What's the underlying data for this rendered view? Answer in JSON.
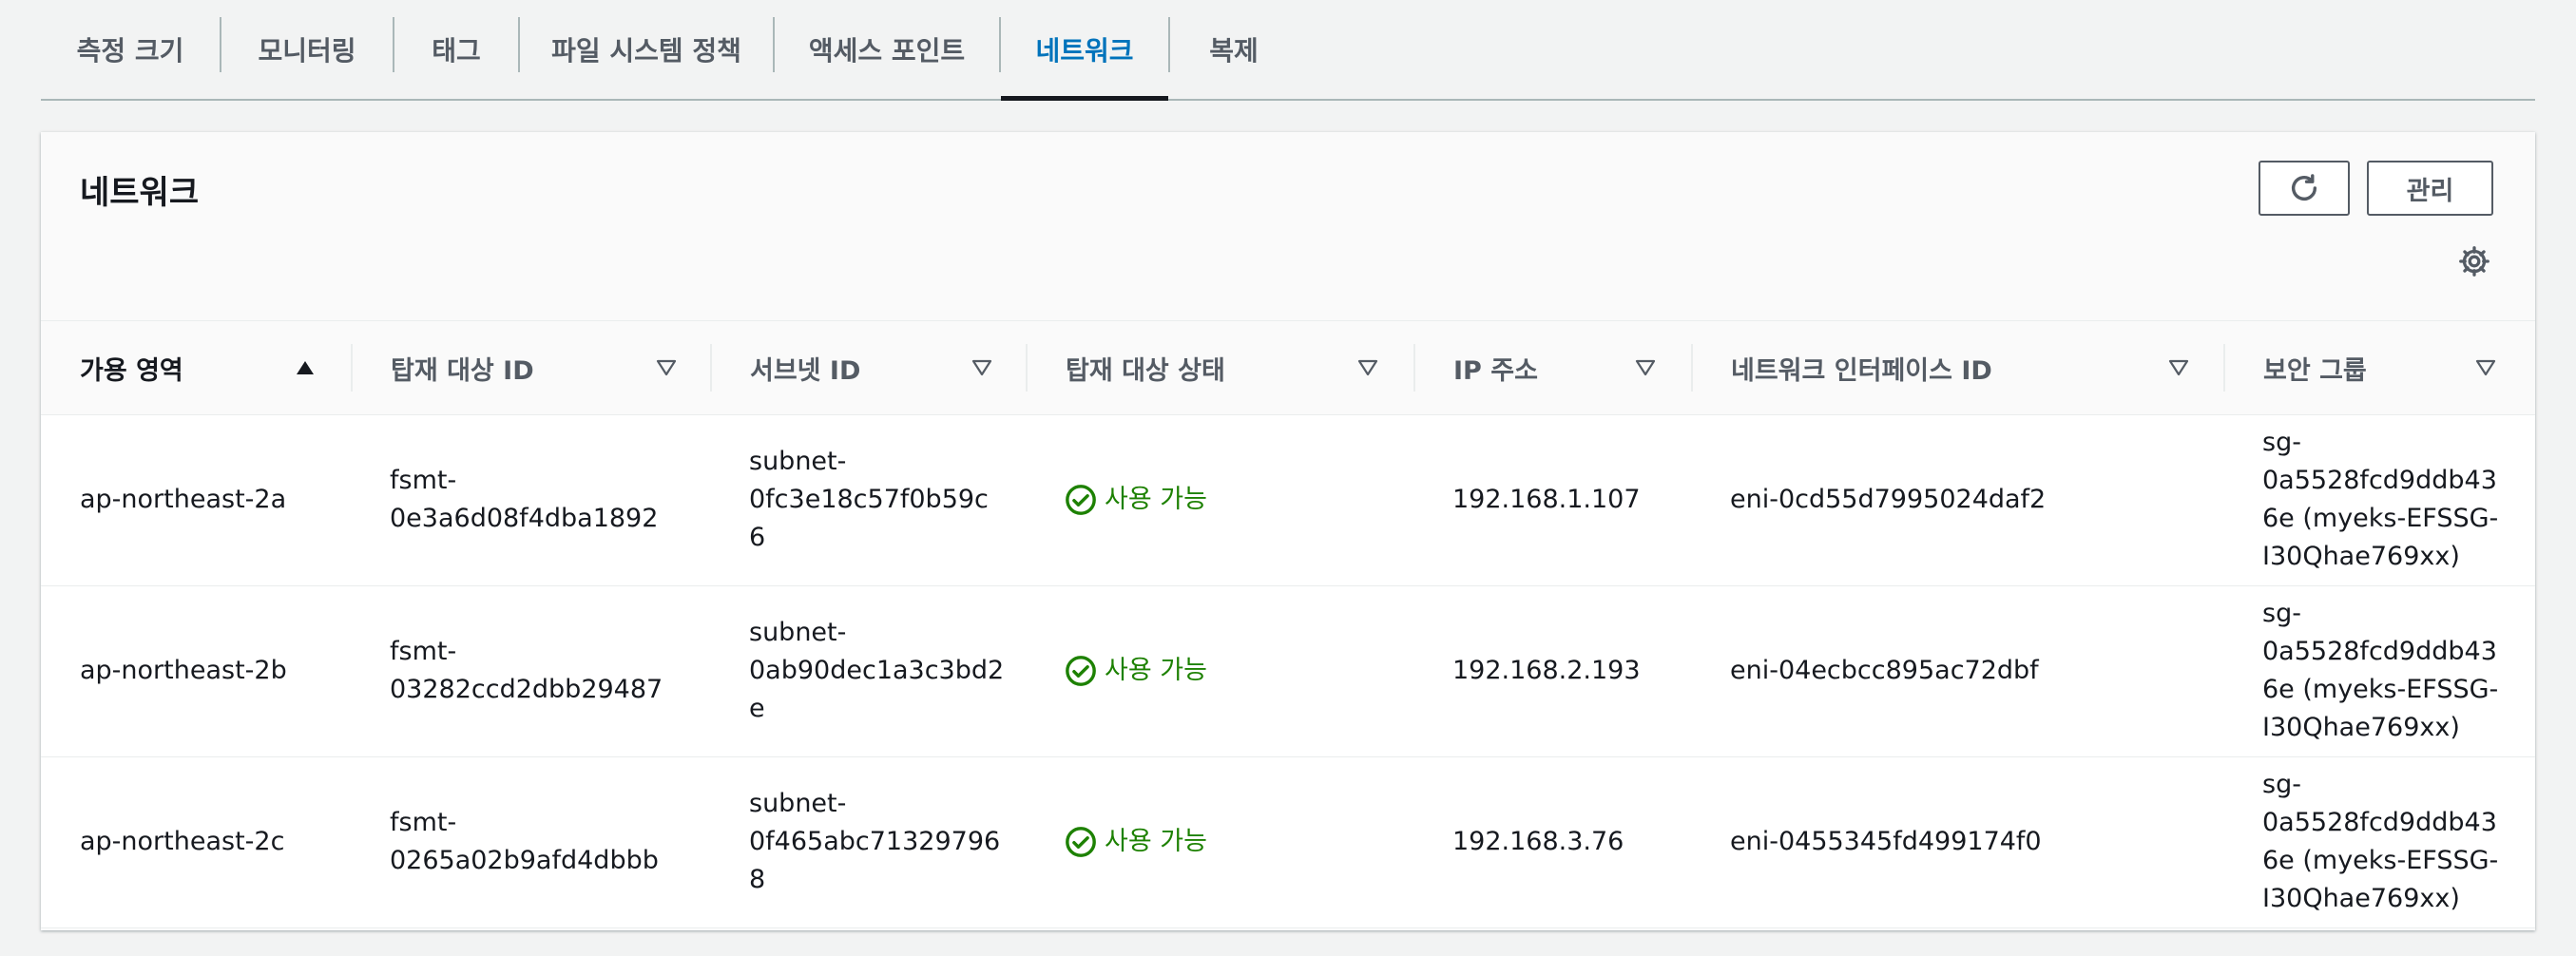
{
  "tabs": [
    {
      "label": "측정 크기"
    },
    {
      "label": "모니터링"
    },
    {
      "label": "태그"
    },
    {
      "label": "파일 시스템 정책"
    },
    {
      "label": "액세스 포인트"
    },
    {
      "label": "네트워크",
      "active": true
    },
    {
      "label": "복제"
    }
  ],
  "panel": {
    "title": "네트워크",
    "refresh_icon": "refresh-icon",
    "manage_label": "관리",
    "settings_icon": "gear-icon"
  },
  "table": {
    "columns": [
      {
        "label": "가용 영역",
        "sort": "ascending"
      },
      {
        "label": "탑재 대상 ID",
        "sort": "none"
      },
      {
        "label": "서브넷 ID",
        "sort": "none"
      },
      {
        "label": "탑재 대상 상태",
        "sort": "none"
      },
      {
        "label": "IP 주소",
        "sort": "none"
      },
      {
        "label": "네트워크 인터페이스 ID",
        "sort": "none"
      },
      {
        "label": "보안 그룹",
        "sort": "none"
      }
    ],
    "rows": [
      {
        "az": "ap-northeast-2a",
        "mount_target_id": "fsmt-\n0e3a6d08f4dba1892",
        "subnet_id": "subnet-\n0fc3e18c57f0b59c\n6",
        "state": "사용 가능",
        "ip": "192.168.1.107",
        "eni": "eni-0cd55d7995024daf2",
        "security_group": "sg-\n0a5528fcd9ddb43\n6e (myeks-EFSSG-\nI30Qhae769xx)"
      },
      {
        "az": "ap-northeast-2b",
        "mount_target_id": "fsmt-\n03282ccd2dbb29487",
        "subnet_id": "subnet-\n0ab90dec1a3c3bd2\ne",
        "state": "사용 가능",
        "ip": "192.168.2.193",
        "eni": "eni-04ecbcc895ac72dbf",
        "security_group": "sg-\n0a5528fcd9ddb43\n6e (myeks-EFSSG-\nI30Qhae769xx)"
      },
      {
        "az": "ap-northeast-2c",
        "mount_target_id": "fsmt-\n0265a02b9afd4dbbb",
        "subnet_id": "subnet-\n0f465abc71329796\n8",
        "state": "사용 가능",
        "ip": "192.168.3.76",
        "eni": "eni-0455345fd499174f0",
        "security_group": "sg-\n0a5528fcd9ddb43\n6e (myeks-EFSSG-\nI30Qhae769xx)"
      }
    ],
    "status_icon": "check-circle-icon",
    "status_color": "#1d8102"
  },
  "colors": {
    "active_tab": "#0073bb",
    "text": "#16191f",
    "muted": "#545b64"
  }
}
